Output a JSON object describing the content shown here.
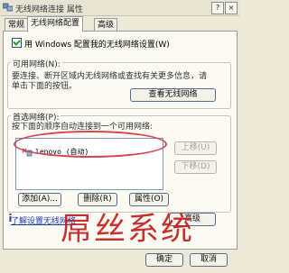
{
  "window": {
    "title": "无线网络连接 属性"
  },
  "title_buttons": {
    "help": "?",
    "close": "×"
  },
  "tabs": {
    "general": "常规",
    "wireless": "无线网络配置",
    "advanced": "高级"
  },
  "use_windows": {
    "label": "用 Windows 配置我的无线网络设置(W)",
    "checked": true
  },
  "available": {
    "title": "可用网络(N):",
    "line1": "要连接、断开区域内无线网络或查找有关更多信息，请",
    "line2": "单击下面的按钮。",
    "button": "查看无线网络"
  },
  "preferred": {
    "title": "首选网络(P):",
    "subtitle": "按下面的顺序自动连接到一个可用网络:",
    "networks": [
      {
        "label": "lenovo (自动)"
      }
    ],
    "move_up": "上移(U)",
    "move_down": "下移(D)",
    "add": "添加(A)...",
    "remove": "删除(R)",
    "properties": "属性(O)"
  },
  "learn_link": "了解设置无线网络",
  "advanced_button": "高级",
  "watermark": "屌丝系统",
  "bottom": {
    "ok": "确定",
    "cancel": "取消"
  },
  "colors": {
    "annotation": "#d64550",
    "watermark": "#c0201e",
    "checkmark": "#21a121",
    "link": "#1f3fb0"
  },
  "icons": {
    "app": "network-icon",
    "network": "wireless-network-icon",
    "info": "info-icon"
  }
}
